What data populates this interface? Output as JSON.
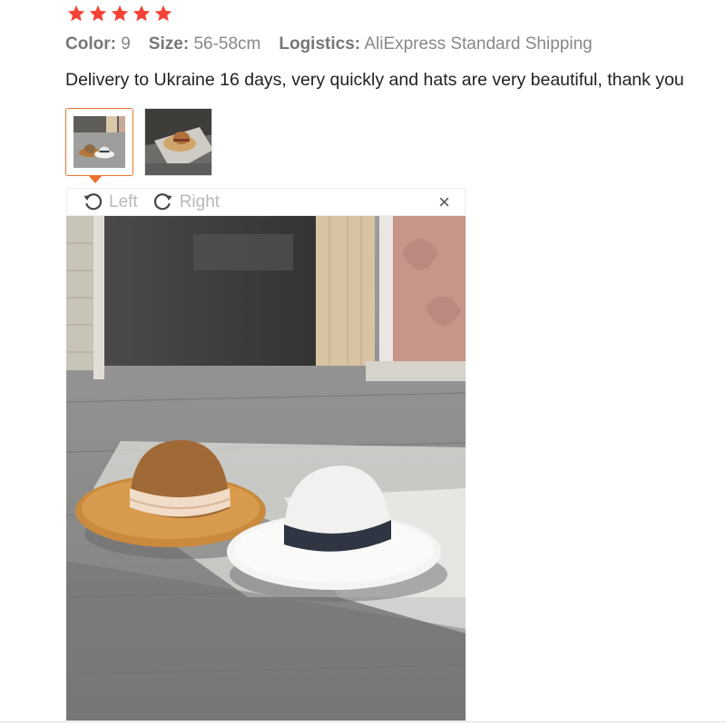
{
  "rating": {
    "stars": 5,
    "color": "#f44336"
  },
  "review_meta": {
    "color_label": "Color:",
    "color_value": "9",
    "size_label": "Size:",
    "size_value": "56-58cm",
    "logistics_label": "Logistics:",
    "logistics_value": "AliExpress Standard Shipping"
  },
  "review_text": "Delivery to Ukraine 16 days, very quickly and hats are very beautiful, thank you",
  "thumbnails": [
    {
      "icon": "hat-photo-thumbnail",
      "selected": true
    },
    {
      "icon": "hat-photo-thumbnail",
      "selected": false
    }
  ],
  "viewer": {
    "rotate_left_label": "Left",
    "rotate_right_label": "Right",
    "close_label": "×"
  },
  "accent_color": "#e8742f"
}
